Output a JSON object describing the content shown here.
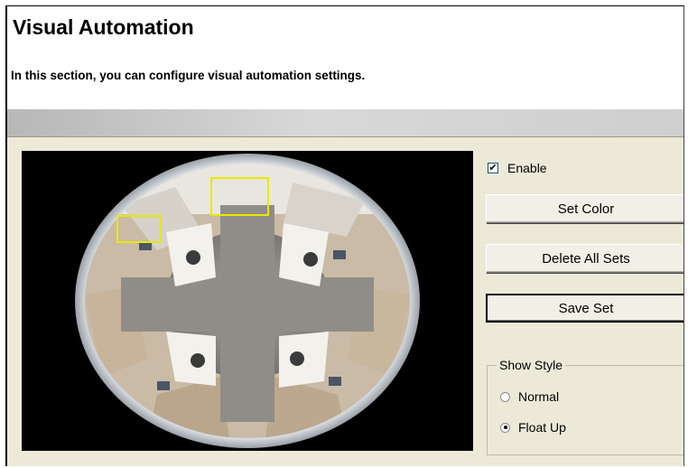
{
  "header": {
    "title": "Visual Automation",
    "description": "In this section, you can configure visual automation settings."
  },
  "controls": {
    "enable_label": "Enable",
    "enable_checked": true,
    "set_color_label": "Set Color",
    "delete_all_sets_label": "Delete All Sets",
    "save_set_label": "Save Set"
  },
  "show_style": {
    "legend": "Show Style",
    "options": [
      {
        "label": "Normal",
        "selected": false
      },
      {
        "label": "Float Up",
        "selected": true
      }
    ]
  },
  "camera_view": {
    "type": "fisheye-office",
    "selection_color": "#e8e800"
  }
}
